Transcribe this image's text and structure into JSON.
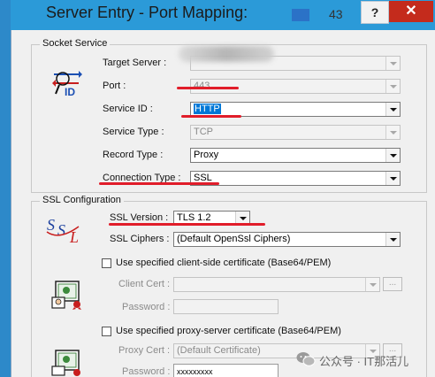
{
  "window": {
    "title": "Server Entry - Port Mapping:",
    "title_suffix": "43",
    "help_label": "?",
    "close_label": "✕"
  },
  "socket_service": {
    "legend": "Socket Service",
    "target_server": {
      "label": "Target Server :",
      "value": ""
    },
    "port": {
      "label": "Port :",
      "value": "443"
    },
    "service_id": {
      "label": "Service ID :",
      "value": "HTTP"
    },
    "service_type": {
      "label": "Service Type :",
      "value": "TCP"
    },
    "record_type": {
      "label": "Record Type :",
      "value": "Proxy"
    },
    "connection_type": {
      "label": "Connection Type :",
      "value": "SSL"
    }
  },
  "ssl_configuration": {
    "legend": "SSL Configuration",
    "ssl_version": {
      "label": "SSL Version :",
      "value": "TLS 1.2"
    },
    "ssl_ciphers": {
      "label": "SSL Ciphers :",
      "value": "(Default OpenSsl Ciphers)"
    },
    "client_cert_checkbox": "Use specified client-side certificate (Base64/PEM)",
    "client_cert": {
      "label": "Client Cert :",
      "value": ""
    },
    "client_password": {
      "label": "Password :",
      "value": ""
    },
    "proxy_cert_checkbox": "Use specified proxy-server certificate (Base64/PEM)",
    "proxy_cert": {
      "label": "Proxy Cert :",
      "value": "(Default Certificate)"
    },
    "proxy_password": {
      "label": "Password :",
      "value": "xxxxxxxxx"
    },
    "browse_label": "..."
  },
  "watermark": {
    "text": "公众号 · IT那活儿"
  },
  "colors": {
    "titlebar": "#2b9ad8",
    "selection": "#0078d7",
    "annotation": "#e11d2a",
    "close": "#c42b1c"
  }
}
